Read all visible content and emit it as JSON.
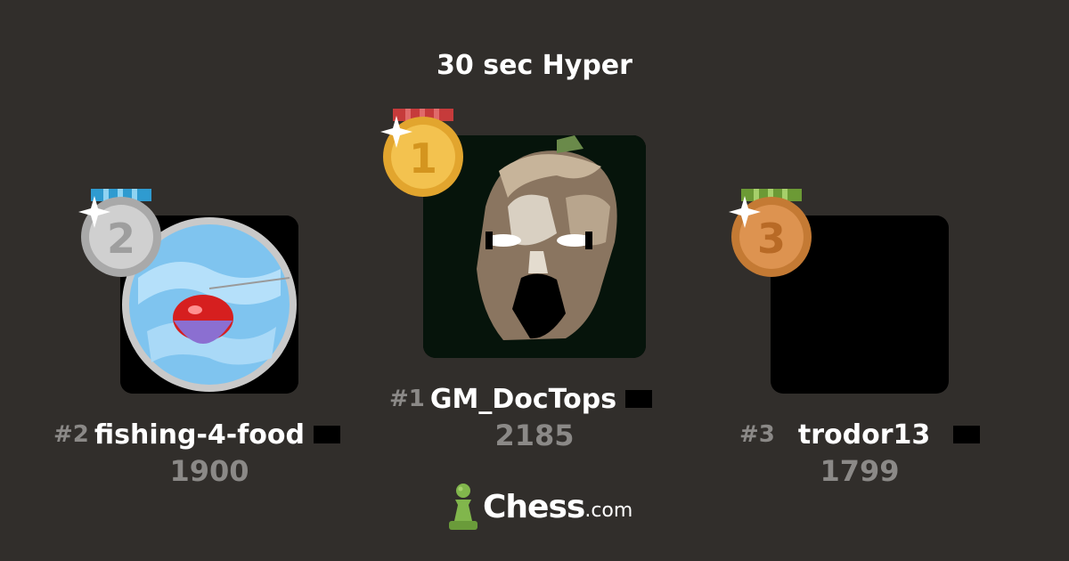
{
  "title": "30 sec Hyper",
  "players": {
    "first": {
      "rank": "#1",
      "username": "GM_DocTops",
      "rating": "2185",
      "medal_digit": "1"
    },
    "second": {
      "rank": "#2",
      "username": "fishing-4-food",
      "rating": "1900",
      "medal_digit": "2"
    },
    "third": {
      "rank": "#3",
      "username": "trodor13",
      "rating": "1799",
      "medal_digit": "3"
    }
  },
  "logo": {
    "name": "Chess",
    "suffix": ".com",
    "icon": "pawn-icon"
  },
  "colors": {
    "background": "#312e2b",
    "gold": "#e9b23a",
    "silver": "#c4c4c4",
    "bronze": "#d0873e",
    "logo_green": "#81b64c"
  }
}
